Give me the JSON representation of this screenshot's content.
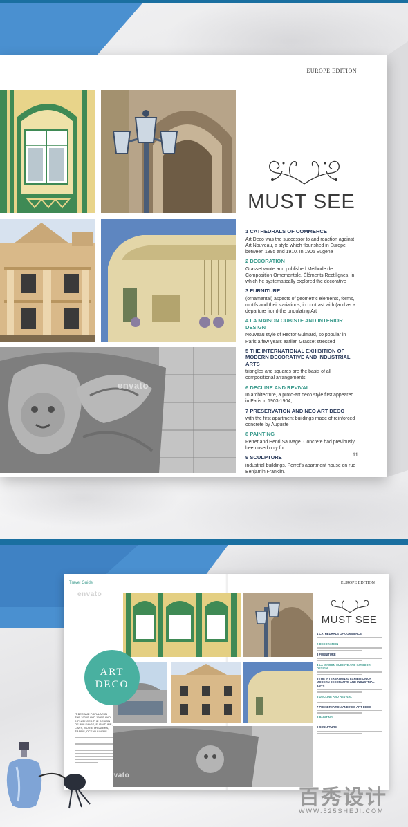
{
  "colors": {
    "accent_teal": "#3a9a8c",
    "heading_dark": "#2a3a5a",
    "bar_blue": "#1a6fa0",
    "background_blue": "#4a90d0"
  },
  "magazine": {
    "edition": "EUROPE EDITION",
    "title": "MUST SEE",
    "page_number": "11",
    "sections": [
      {
        "heading": "1 CATHEDRALS OF COMMERCE",
        "color": "dark",
        "body": "Art Deco was the successor to and reaction against Art Nouveau, a style which flourished in Europe between 1895 and 1910. In 1905 Eugène"
      },
      {
        "heading": "2 DECORATION",
        "color": "teal",
        "body": "Grasset wrote and published Méthode de Composition Ornementale, Éléments Rectilignes, in which he systematically explored the decorative"
      },
      {
        "heading": "3 FURNITURE",
        "color": "dark",
        "body": "(ornamental) aspects of geometric elements, forms, motifs and their variations, in contrast with (and as a departure from) the undulating Art"
      },
      {
        "heading": "4 LA MAISON CUBISTE AND INTERIOR DESIGN",
        "color": "teal",
        "body": "Nouveau style of Hector Guimard, so popular in Paris a few years earlier. Grasset stressed"
      },
      {
        "heading": "5 THE INTERNATIONAL EXHIBITION OF MODERN DECORATIVE AND INDUSTRIAL ARTS",
        "color": "dark",
        "body": "triangles and squares are the basis of all compositional arrangements."
      },
      {
        "heading": "6 DECLINE AND REVIVAL",
        "color": "teal",
        "body": "In architecture, a proto-art deco style first appeared in Paris in 1903-1904,"
      },
      {
        "heading": "7 PRESERVATION AND NEO ART DECO",
        "color": "dark",
        "body": "with the first apartment buildings made of reinforced concrete by Auguste"
      },
      {
        "heading": "8 PAINTING",
        "color": "teal",
        "body": "Perret and Henri Sauvage. Concrete had previously been used only for"
      },
      {
        "heading": "9 SCULPTURE",
        "color": "dark",
        "body": "industrial buildings. Perret's apartment house on rue Benjamin Franklin."
      }
    ],
    "watermark": "envato"
  },
  "spread": {
    "travel_guide": "Travel Guide",
    "edition": "EUROPE EDITION",
    "art_deco_line1": "ART",
    "art_deco_line2": "DECO",
    "title": "MUST SEE",
    "watermark": "envato",
    "intro_text": "IT BECAME POPULAR IN THE 1920S AND 1930S AND INFLUENCED THE DESIGN OF BUILDINGS, FURNITURE, CARS, MOVIE THEATERS, TRAINS, OCEAN LINERS",
    "sections": [
      {
        "heading": "1 CATHEDRALS OF COMMERCE",
        "color": "dark"
      },
      {
        "heading": "2 DECORATION",
        "color": "teal"
      },
      {
        "heading": "3 FURNITURE",
        "color": "dark"
      },
      {
        "heading": "4 LA MAISON CUBISTE AND INTERIOR DESIGN",
        "color": "teal"
      },
      {
        "heading": "5 THE INTERNATIONAL EXHIBITION OF MODERN DECORATIVE AND INDUSTRIAL ARTS",
        "color": "dark"
      },
      {
        "heading": "6 DECLINE AND REVIVAL",
        "color": "teal"
      },
      {
        "heading": "7 PRESERVATION AND NEO ART DECO",
        "color": "dark"
      },
      {
        "heading": "8 PAINTING",
        "color": "teal"
      },
      {
        "heading": "9 SCULPTURE",
        "color": "dark"
      }
    ]
  },
  "brand": {
    "mark": "百秀设计",
    "url": "WWW.525SHEJI.COM"
  }
}
